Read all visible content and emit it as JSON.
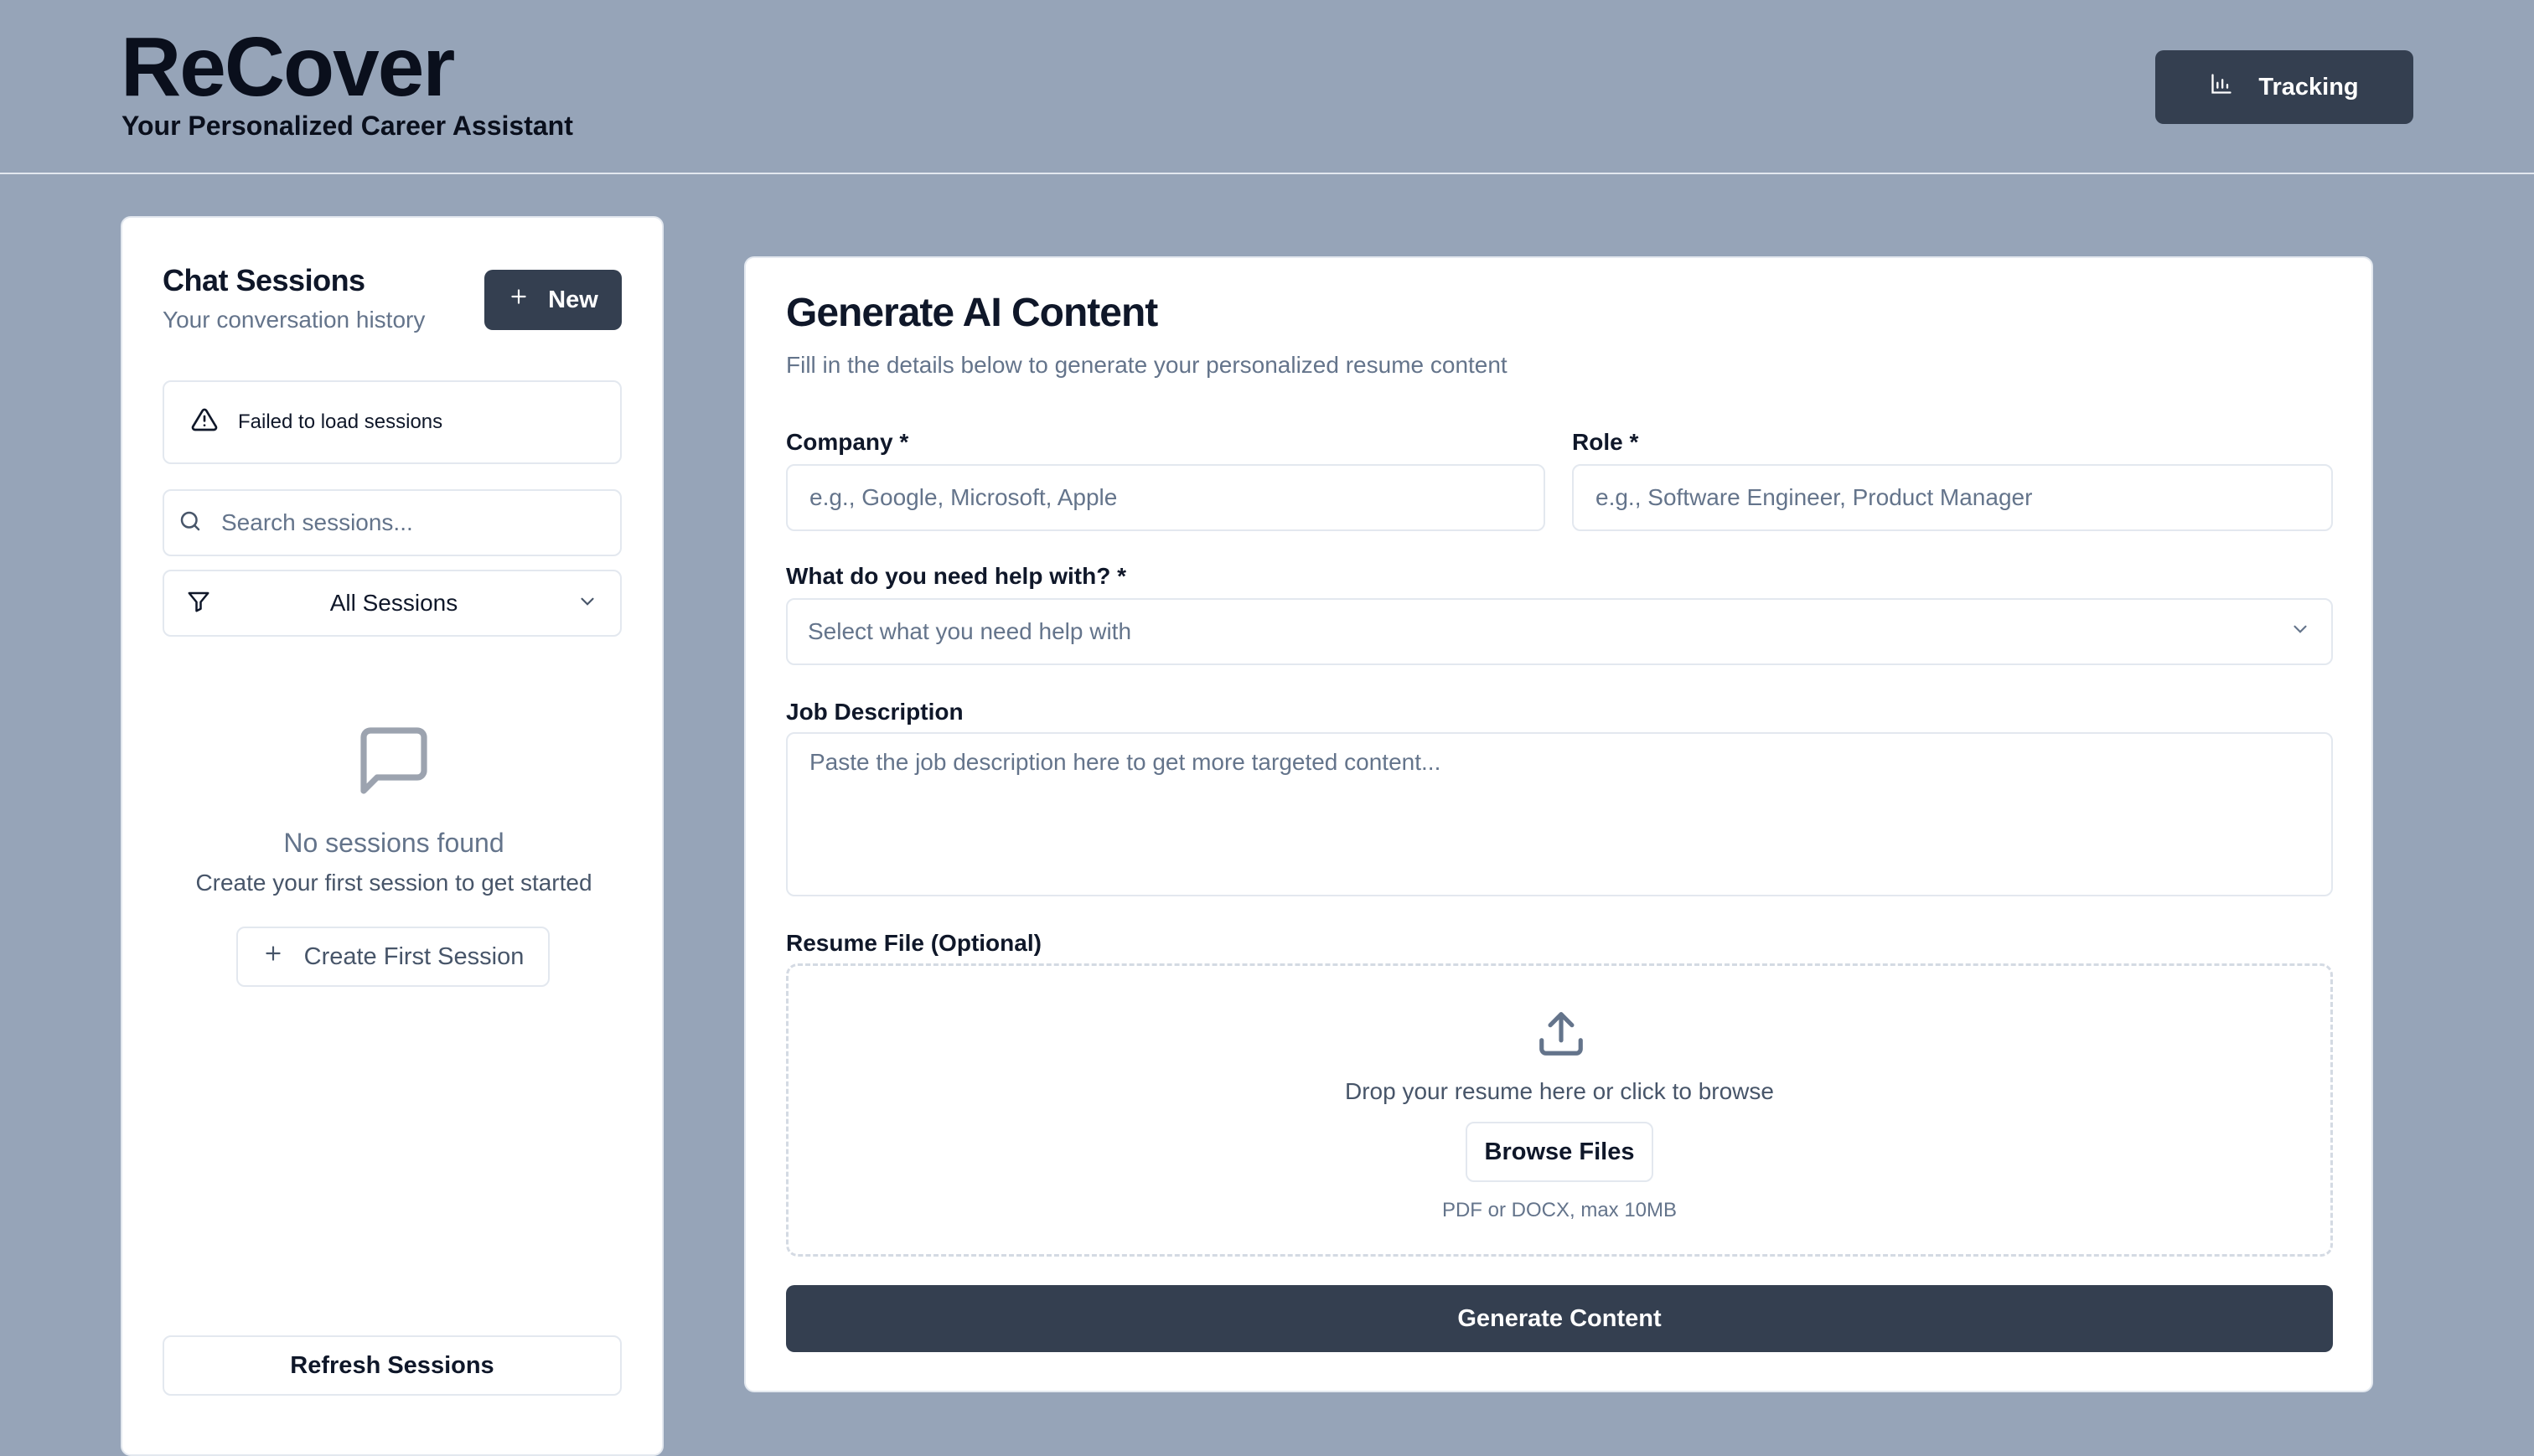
{
  "header": {
    "title": "ReCover",
    "subtitle": "Your Personalized Career Assistant",
    "tracking_label": "Tracking",
    "tracking_icon": "bar-chart-icon"
  },
  "sidebar": {
    "title": "Chat Sessions",
    "subtitle": "Your conversation history",
    "new_label": "New",
    "error_text": "Failed to load sessions",
    "search_placeholder": "Search sessions...",
    "filter_selected": "All Sessions",
    "empty_title": "No sessions found",
    "empty_subtitle": "Create your first session to get started",
    "create_first_label": "Create First Session",
    "refresh_label": "Refresh Sessions"
  },
  "main": {
    "title": "Generate AI Content",
    "subtitle": "Fill in the details below to generate your personalized resume content",
    "company_label": "Company *",
    "company_placeholder": "e.g., Google, Microsoft, Apple",
    "role_label": "Role *",
    "role_placeholder": "e.g., Software Engineer, Product Manager",
    "help_label": "What do you need help with? *",
    "help_placeholder": "Select what you need help with",
    "jd_label": "Job Description",
    "jd_placeholder": "Paste the job description here to get more targeted content...",
    "resume_label": "Resume File (Optional)",
    "drop_text": "Drop your resume here or click to browse",
    "browse_label": "Browse Files",
    "file_hint": "PDF or DOCX, max 10MB",
    "generate_label": "Generate Content"
  },
  "colors": {
    "background": "#96a4b8",
    "primary_button": "#343f50",
    "card": "#ffffff",
    "border": "#e3e8ef",
    "muted_text": "#64748b"
  }
}
